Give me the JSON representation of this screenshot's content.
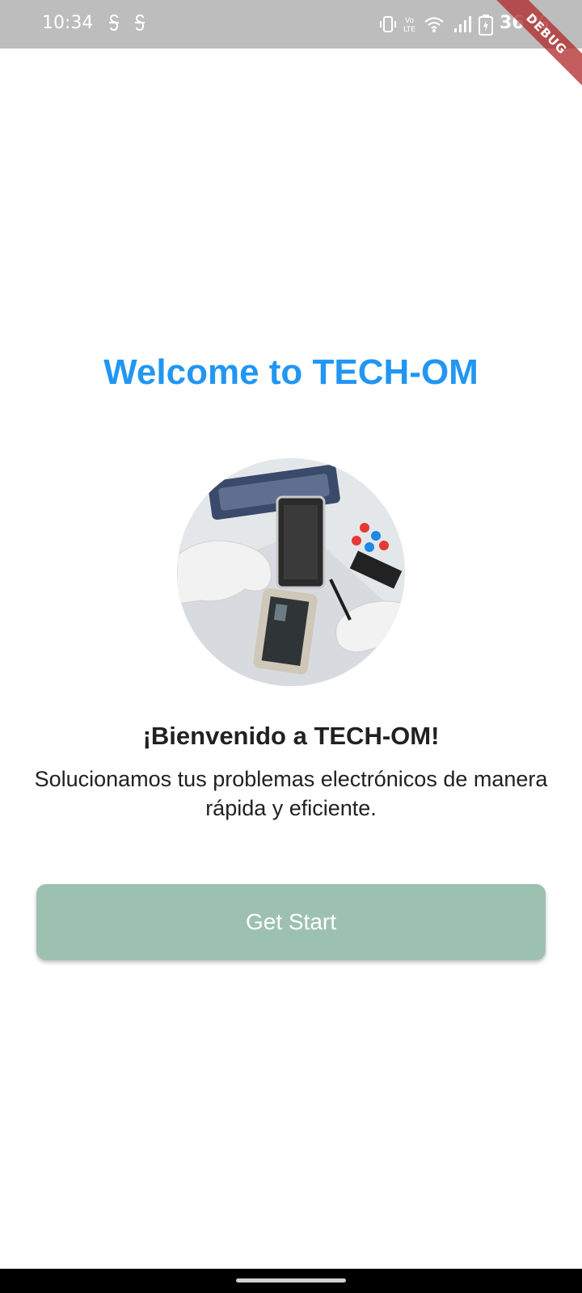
{
  "status_bar": {
    "time": "10:34",
    "notification_icons": [
      "s-app-icon",
      "s-app-icon"
    ],
    "system_icons": [
      "vibrate-icon",
      "volte-icon",
      "wifi-icon",
      "signal-icon",
      "battery-charging-icon"
    ],
    "battery": "36 %"
  },
  "debug_banner": "DEBUG",
  "welcome": {
    "title": "Welcome to TECH-OM",
    "greeting": "¡Bienvenido a TECH-OM!",
    "subtitle": "Solucionamos tus problemas electrónicos de manera rápida y eficiente."
  },
  "cta": {
    "label": "Get Start"
  },
  "colors": {
    "title": "#2196f3",
    "button": "#9dc1b0",
    "status_bar": "#bdbdbd"
  }
}
